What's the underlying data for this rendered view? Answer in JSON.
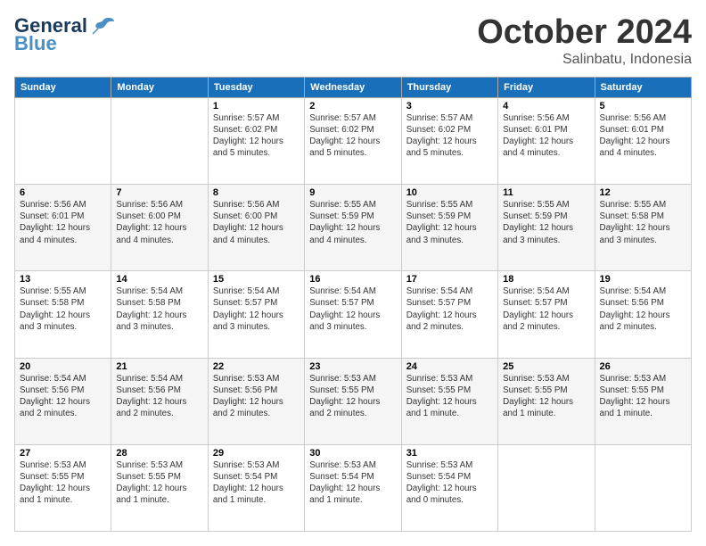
{
  "logo": {
    "general": "General",
    "blue": "Blue",
    "tagline": ""
  },
  "header": {
    "month": "October 2024",
    "location": "Salinbatu, Indonesia"
  },
  "weekdays": [
    "Sunday",
    "Monday",
    "Tuesday",
    "Wednesday",
    "Thursday",
    "Friday",
    "Saturday"
  ],
  "weeks": [
    [
      {
        "day": "",
        "info": ""
      },
      {
        "day": "",
        "info": ""
      },
      {
        "day": "1",
        "info": "Sunrise: 5:57 AM\nSunset: 6:02 PM\nDaylight: 12 hours\nand 5 minutes."
      },
      {
        "day": "2",
        "info": "Sunrise: 5:57 AM\nSunset: 6:02 PM\nDaylight: 12 hours\nand 5 minutes."
      },
      {
        "day": "3",
        "info": "Sunrise: 5:57 AM\nSunset: 6:02 PM\nDaylight: 12 hours\nand 5 minutes."
      },
      {
        "day": "4",
        "info": "Sunrise: 5:56 AM\nSunset: 6:01 PM\nDaylight: 12 hours\nand 4 minutes."
      },
      {
        "day": "5",
        "info": "Sunrise: 5:56 AM\nSunset: 6:01 PM\nDaylight: 12 hours\nand 4 minutes."
      }
    ],
    [
      {
        "day": "6",
        "info": "Sunrise: 5:56 AM\nSunset: 6:01 PM\nDaylight: 12 hours\nand 4 minutes."
      },
      {
        "day": "7",
        "info": "Sunrise: 5:56 AM\nSunset: 6:00 PM\nDaylight: 12 hours\nand 4 minutes."
      },
      {
        "day": "8",
        "info": "Sunrise: 5:56 AM\nSunset: 6:00 PM\nDaylight: 12 hours\nand 4 minutes."
      },
      {
        "day": "9",
        "info": "Sunrise: 5:55 AM\nSunset: 5:59 PM\nDaylight: 12 hours\nand 4 minutes."
      },
      {
        "day": "10",
        "info": "Sunrise: 5:55 AM\nSunset: 5:59 PM\nDaylight: 12 hours\nand 3 minutes."
      },
      {
        "day": "11",
        "info": "Sunrise: 5:55 AM\nSunset: 5:59 PM\nDaylight: 12 hours\nand 3 minutes."
      },
      {
        "day": "12",
        "info": "Sunrise: 5:55 AM\nSunset: 5:58 PM\nDaylight: 12 hours\nand 3 minutes."
      }
    ],
    [
      {
        "day": "13",
        "info": "Sunrise: 5:55 AM\nSunset: 5:58 PM\nDaylight: 12 hours\nand 3 minutes."
      },
      {
        "day": "14",
        "info": "Sunrise: 5:54 AM\nSunset: 5:58 PM\nDaylight: 12 hours\nand 3 minutes."
      },
      {
        "day": "15",
        "info": "Sunrise: 5:54 AM\nSunset: 5:57 PM\nDaylight: 12 hours\nand 3 minutes."
      },
      {
        "day": "16",
        "info": "Sunrise: 5:54 AM\nSunset: 5:57 PM\nDaylight: 12 hours\nand 3 minutes."
      },
      {
        "day": "17",
        "info": "Sunrise: 5:54 AM\nSunset: 5:57 PM\nDaylight: 12 hours\nand 2 minutes."
      },
      {
        "day": "18",
        "info": "Sunrise: 5:54 AM\nSunset: 5:57 PM\nDaylight: 12 hours\nand 2 minutes."
      },
      {
        "day": "19",
        "info": "Sunrise: 5:54 AM\nSunset: 5:56 PM\nDaylight: 12 hours\nand 2 minutes."
      }
    ],
    [
      {
        "day": "20",
        "info": "Sunrise: 5:54 AM\nSunset: 5:56 PM\nDaylight: 12 hours\nand 2 minutes."
      },
      {
        "day": "21",
        "info": "Sunrise: 5:54 AM\nSunset: 5:56 PM\nDaylight: 12 hours\nand 2 minutes."
      },
      {
        "day": "22",
        "info": "Sunrise: 5:53 AM\nSunset: 5:56 PM\nDaylight: 12 hours\nand 2 minutes."
      },
      {
        "day": "23",
        "info": "Sunrise: 5:53 AM\nSunset: 5:55 PM\nDaylight: 12 hours\nand 2 minutes."
      },
      {
        "day": "24",
        "info": "Sunrise: 5:53 AM\nSunset: 5:55 PM\nDaylight: 12 hours\nand 1 minute."
      },
      {
        "day": "25",
        "info": "Sunrise: 5:53 AM\nSunset: 5:55 PM\nDaylight: 12 hours\nand 1 minute."
      },
      {
        "day": "26",
        "info": "Sunrise: 5:53 AM\nSunset: 5:55 PM\nDaylight: 12 hours\nand 1 minute."
      }
    ],
    [
      {
        "day": "27",
        "info": "Sunrise: 5:53 AM\nSunset: 5:55 PM\nDaylight: 12 hours\nand 1 minute."
      },
      {
        "day": "28",
        "info": "Sunrise: 5:53 AM\nSunset: 5:55 PM\nDaylight: 12 hours\nand 1 minute."
      },
      {
        "day": "29",
        "info": "Sunrise: 5:53 AM\nSunset: 5:54 PM\nDaylight: 12 hours\nand 1 minute."
      },
      {
        "day": "30",
        "info": "Sunrise: 5:53 AM\nSunset: 5:54 PM\nDaylight: 12 hours\nand 1 minute."
      },
      {
        "day": "31",
        "info": "Sunrise: 5:53 AM\nSunset: 5:54 PM\nDaylight: 12 hours\nand 0 minutes."
      },
      {
        "day": "",
        "info": ""
      },
      {
        "day": "",
        "info": ""
      }
    ]
  ]
}
